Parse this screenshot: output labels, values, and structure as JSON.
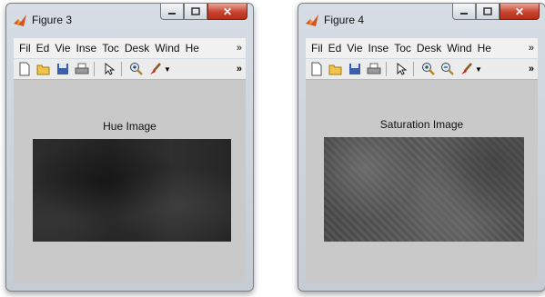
{
  "windows": [
    {
      "title": "Figure 3",
      "menu": [
        "Fil",
        "Ed",
        "Vie",
        "Inse",
        "Toc",
        "Desk",
        "Wind",
        "He"
      ],
      "menu_more": "»",
      "toolbar_more": "»",
      "plot_title": "Hue Image",
      "image_icon": "grayscale-hue-image"
    },
    {
      "title": "Figure 4",
      "menu": [
        "Fil",
        "Ed",
        "Vie",
        "Inse",
        "Toc",
        "Desk",
        "Wind",
        "He"
      ],
      "menu_more": "»",
      "toolbar_more": "»",
      "plot_title": "Saturation Image",
      "image_icon": "grayscale-saturation-image"
    }
  ],
  "controls": {
    "close": "✕"
  },
  "colors": {
    "close": "#c7432e",
    "client": "#c9c9c9",
    "frame": "#d0d7de"
  }
}
